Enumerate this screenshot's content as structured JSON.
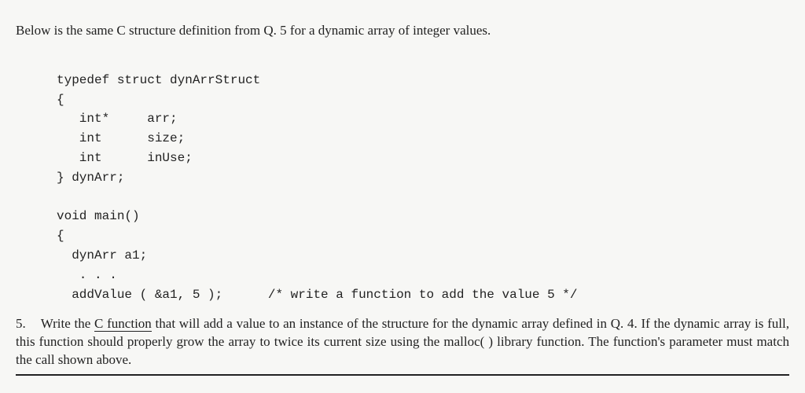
{
  "intro": "Below is the same C structure definition from Q. 5 for a dynamic array of integer values.",
  "code": {
    "l1": "typedef struct dynArrStruct",
    "l2": "{",
    "l3": "   int*     arr;",
    "l4": "   int      size;",
    "l5": "   int      inUse;",
    "l6": "} dynArr;",
    "l7": "",
    "l8": "void main()",
    "l9": "{",
    "l10": "  dynArr a1;",
    "l11": "   . . .",
    "l12a": "  addValue ( &a1, 5 );",
    "l12b": "      /* write a function to add the value 5 */"
  },
  "question": {
    "num": "5.",
    "part1": "Write the ",
    "underlined": "C function",
    "part2": " that will add a value to an instance of the structure for the dynamic array defined in Q. 4.  If the dynamic array is full, this function should properly grow the array to twice its current size using the malloc( ) library function.   The function's parameter must match the call shown above."
  }
}
